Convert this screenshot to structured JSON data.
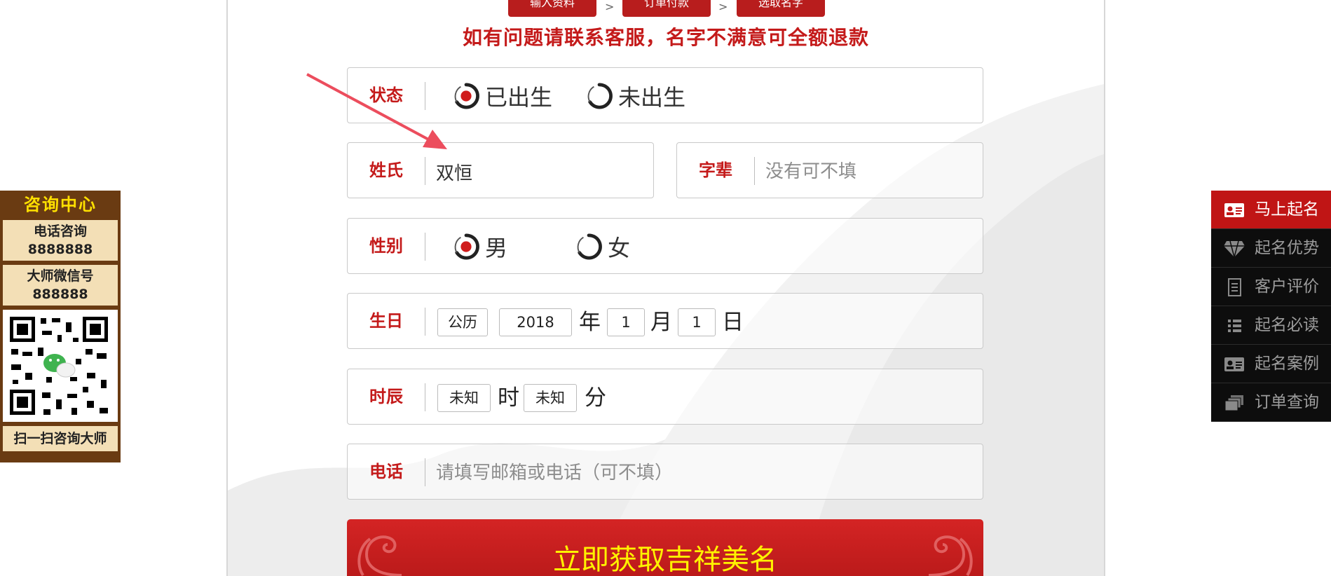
{
  "steps": {
    "step1": "输入资料",
    "step2": "订单付款",
    "step3": "选取名字",
    "arrow": ">"
  },
  "notice": "如有问题请联系客服，名字不满意可全额退款",
  "form": {
    "status": {
      "label": "状态",
      "options": [
        "已出生",
        "未出生"
      ],
      "selected": "已出生"
    },
    "surname": {
      "label": "姓氏",
      "value": "双恒"
    },
    "generation": {
      "label": "字辈",
      "placeholder": "没有可不填"
    },
    "gender": {
      "label": "性别",
      "options": [
        "男",
        "女"
      ],
      "selected": "男"
    },
    "birthday": {
      "label": "生日",
      "calendar": "公历",
      "year": "2018",
      "year_unit": "年",
      "month": "1",
      "month_unit": "月",
      "day": "1",
      "day_unit": "日"
    },
    "birth_time": {
      "label": "时辰",
      "hour": "未知",
      "hour_unit": "时",
      "minute": "未知",
      "minute_unit": "分"
    },
    "phone": {
      "label": "电话",
      "placeholder": "请填写邮箱或电话（可不填）"
    },
    "submit_label": "立即获取吉祥美名"
  },
  "consult": {
    "title": "咨询中心",
    "phone_label": "电话咨询",
    "phone_number": "8888888",
    "wechat_label": "大师微信号",
    "wechat_id": "888888",
    "qr_caption": "扫一扫咨询大师"
  },
  "right_nav": [
    {
      "label": "马上起名",
      "icon": "id-card-icon",
      "active": true
    },
    {
      "label": "起名优势",
      "icon": "diamond-icon",
      "active": false
    },
    {
      "label": "客户评价",
      "icon": "document-icon",
      "active": false
    },
    {
      "label": "起名必读",
      "icon": "list-icon",
      "active": false
    },
    {
      "label": "起名案例",
      "icon": "id-card-icon",
      "active": false
    },
    {
      "label": "订单查询",
      "icon": "stack-icon",
      "active": false
    }
  ],
  "colors": {
    "brand_red": "#c41a1a",
    "button_text": "#fff200",
    "consult_brown": "#6a3b12",
    "consult_card": "#f3dfb6",
    "nav_dark": "#0d0d0d",
    "nav_active": "#c01515"
  }
}
